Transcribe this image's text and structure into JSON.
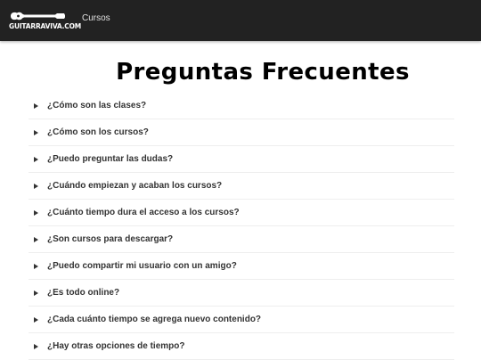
{
  "header": {
    "logo_text": "GUITARRAVIVA.COM",
    "nav": [
      {
        "label": "Cursos"
      }
    ]
  },
  "main": {
    "title": "Preguntas Frecuentes",
    "faq": [
      {
        "question": "¿Cómo son las clases?"
      },
      {
        "question": "¿Cómo son los cursos?"
      },
      {
        "question": "¿Puedo preguntar las dudas?"
      },
      {
        "question": "¿Cuándo empiezan y acaban los cursos?"
      },
      {
        "question": "¿Cuánto tiempo dura el acceso a los cursos?"
      },
      {
        "question": "¿Son cursos para descargar?"
      },
      {
        "question": "¿Puedo compartir mi usuario con un amigo?"
      },
      {
        "question": "¿Es todo online?"
      },
      {
        "question": "¿Cada cuánto tiempo se agrega nuevo contenido?"
      },
      {
        "question": "¿Hay otras opciones de tiempo?"
      }
    ]
  },
  "colors": {
    "header_bg": "#222222",
    "title": "#000000",
    "text": "#333333"
  },
  "icons": {
    "logo": "guitar-icon",
    "faq_toggle": "caret-right-icon"
  }
}
